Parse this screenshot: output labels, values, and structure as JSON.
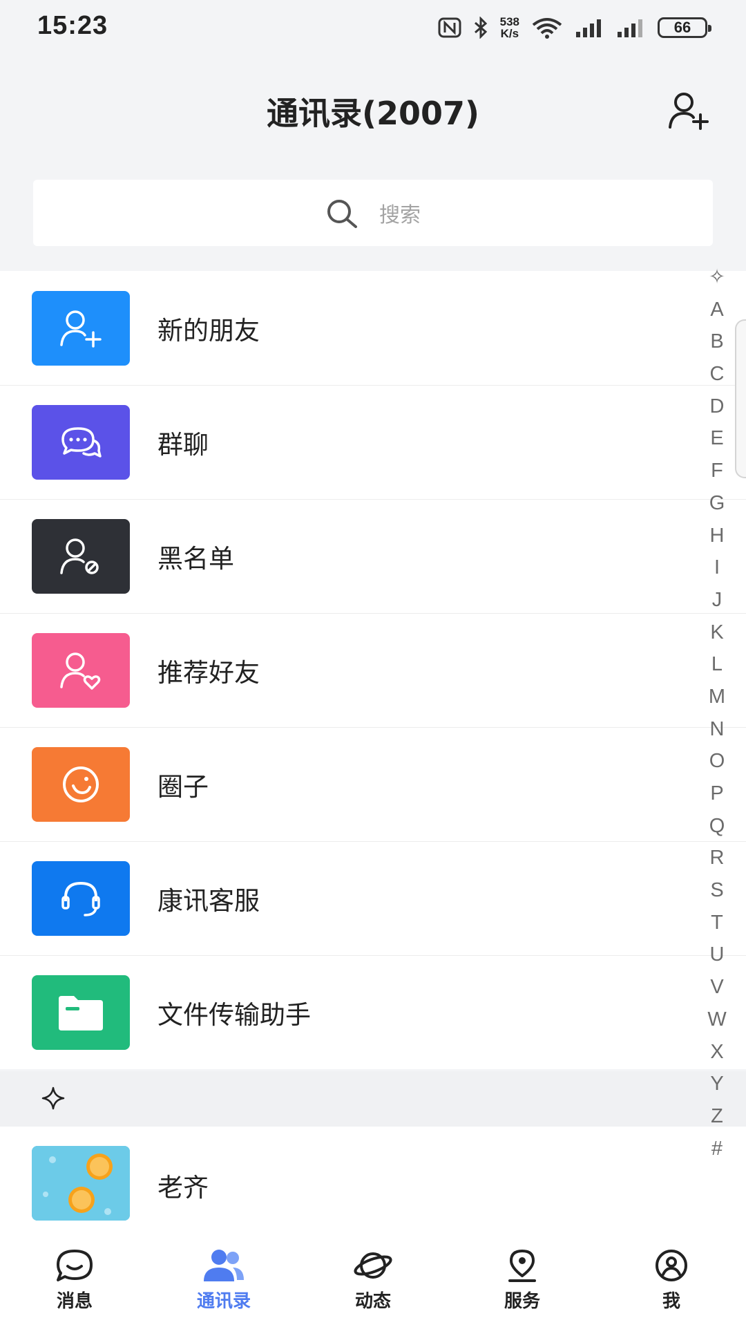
{
  "status_bar": {
    "time": "15:23",
    "net_speed_value": "538",
    "net_speed_unit": "K/s",
    "battery": "66",
    "icons": [
      "nfc-icon",
      "bluetooth-icon",
      "wifi-icon",
      "signal-icon",
      "signal-icon",
      "battery-icon"
    ]
  },
  "header": {
    "title": "通讯录(2007)",
    "add_icon": "add-contact-icon"
  },
  "search": {
    "placeholder": "搜索",
    "icon": "search-icon"
  },
  "functions": [
    {
      "label": "新的朋友",
      "icon": "add-friend-icon",
      "color": "#1e8ffb"
    },
    {
      "label": "群聊",
      "icon": "group-chat-icon",
      "color": "#5b52e8"
    },
    {
      "label": "黑名单",
      "icon": "blacklist-icon",
      "color": "#2e3036"
    },
    {
      "label": "推荐好友",
      "icon": "recommend-friend-icon",
      "color": "#f65c8f"
    },
    {
      "label": "圈子",
      "icon": "circle-icon",
      "color": "#f67a34"
    },
    {
      "label": "康讯客服",
      "icon": "headset-icon",
      "color": "#0f79ef"
    },
    {
      "label": "文件传输助手",
      "icon": "folder-icon",
      "color": "#21bb7c"
    }
  ],
  "section": {
    "symbol": "✧"
  },
  "contacts": [
    {
      "name": "老齐",
      "avatar": "orange-slices-avatar"
    }
  ],
  "alpha_index": [
    "✧",
    "A",
    "B",
    "C",
    "D",
    "E",
    "F",
    "G",
    "H",
    "I",
    "J",
    "K",
    "L",
    "M",
    "N",
    "O",
    "P",
    "Q",
    "R",
    "S",
    "T",
    "U",
    "V",
    "W",
    "X",
    "Y",
    "Z",
    "#"
  ],
  "bottom_nav": [
    {
      "label": "消息",
      "icon": "message-icon",
      "active": false
    },
    {
      "label": "通讯录",
      "icon": "contacts-icon",
      "active": true
    },
    {
      "label": "动态",
      "icon": "planet-icon",
      "active": false
    },
    {
      "label": "服务",
      "icon": "location-icon",
      "active": false
    },
    {
      "label": "我",
      "icon": "profile-icon",
      "active": false
    }
  ],
  "colors": {
    "accent": "#4f7cf0",
    "background": "#f3f4f6"
  }
}
